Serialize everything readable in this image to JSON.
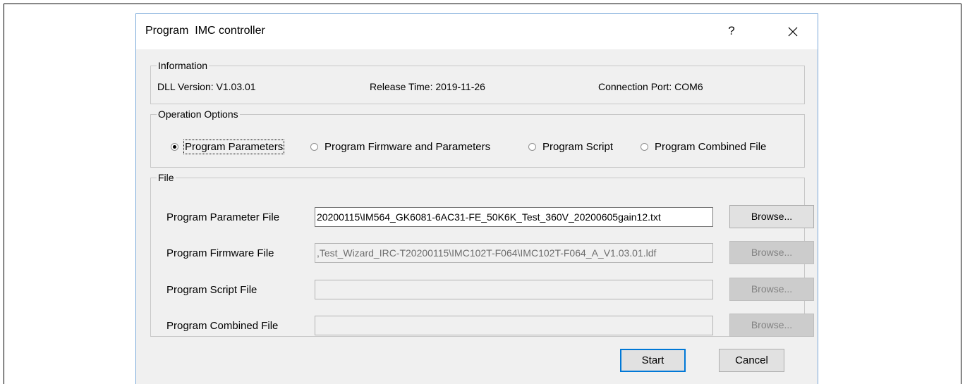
{
  "dialog": {
    "title": "Program  IMC controller",
    "help_label": "?",
    "close_label": "✕"
  },
  "information": {
    "label": "Information",
    "dll_version": "DLL Version: V1.03.01",
    "release_time": "Release Time: 2019-11-26",
    "connection_port": "Connection Port: COM6"
  },
  "operation_options": {
    "label": "Operation Options",
    "options": [
      {
        "label": "Program Parameters",
        "checked": true
      },
      {
        "label": "Program Firmware and Parameters",
        "checked": false
      },
      {
        "label": "Program Script",
        "checked": false
      },
      {
        "label": "Program Combined File",
        "checked": false
      }
    ]
  },
  "file": {
    "label": "File",
    "rows": [
      {
        "label": "Program Parameter File",
        "value": "20200115\\IM564_GK6081-6AC31-FE_50K6K_Test_360V_20200605gain12.txt",
        "enabled": true,
        "browse_label": "Browse..."
      },
      {
        "label": "Program Firmware File",
        "value": ",Test_Wizard_IRC-T20200115\\IMC102T-F064\\IMC102T-F064_A_V1.03.01.ldf",
        "enabled": false,
        "browse_label": "Browse..."
      },
      {
        "label": "Program Script File",
        "value": "",
        "enabled": false,
        "browse_label": "Browse..."
      },
      {
        "label": "Program Combined File",
        "value": "",
        "enabled": false,
        "browse_label": "Browse..."
      }
    ]
  },
  "actions": {
    "start_label": "Start",
    "cancel_label": "Cancel"
  }
}
